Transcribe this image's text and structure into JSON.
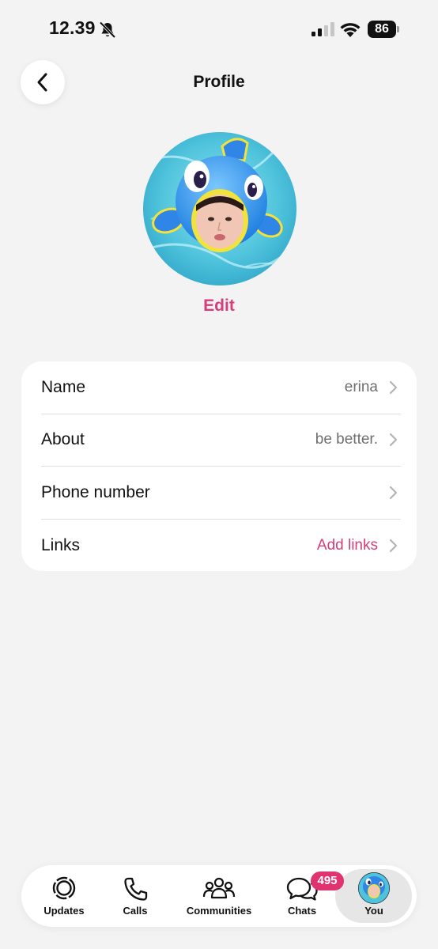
{
  "colors": {
    "accent": "#d63d7a",
    "background": "#f3f3f3",
    "card": "#ffffff",
    "badge": "#e0336f"
  },
  "status_bar": {
    "time": "12.39",
    "silent_icon": "bell-slash-icon",
    "signal_icon": "cellular-signal-icon",
    "wifi_icon": "wifi-icon",
    "battery_level": "86"
  },
  "header": {
    "title": "Profile",
    "back_icon": "chevron-left-icon"
  },
  "profile": {
    "avatar": "profile-photo-fish-hat",
    "edit_label": "Edit"
  },
  "rows": [
    {
      "label": "Name",
      "value": "erina"
    },
    {
      "label": "About",
      "value": "be better."
    },
    {
      "label": "Phone number",
      "value": ""
    },
    {
      "label": "Links",
      "value": "Add links"
    }
  ],
  "bottom_nav": {
    "items": [
      {
        "label": "Updates",
        "icon": "updates-icon"
      },
      {
        "label": "Calls",
        "icon": "phone-icon"
      },
      {
        "label": "Communities",
        "icon": "communities-icon"
      },
      {
        "label": "Chats",
        "icon": "chats-icon",
        "badge": "495"
      },
      {
        "label": "You",
        "icon": "avatar",
        "selected": true
      }
    ]
  }
}
